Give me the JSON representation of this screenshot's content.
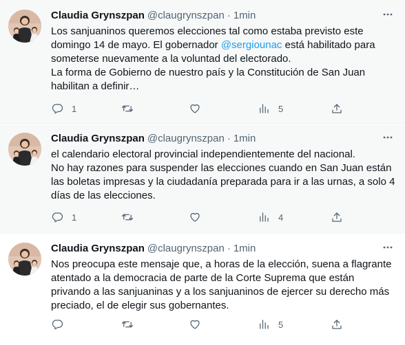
{
  "tweets": [
    {
      "author": "Claudia Grynszpan",
      "handle": "@claugrynszpan",
      "separator": "·",
      "time": "1min",
      "text_before_mention": "Los sanjuaninos queremos elecciones tal como estaba previsto este domingo 14 de mayo. El gobernador ",
      "mention": "@sergiounac",
      "text_after_mention": " está habilitado para someterse nuevamente a la voluntad del electorado.",
      "text_line2": "La forma de Gobierno de nuestro país y la Constitución de San Juan habilitan a definir…",
      "replies": "1",
      "retweets": "",
      "likes": "",
      "views": "5"
    },
    {
      "author": "Claudia Grynszpan",
      "handle": "@claugrynszpan",
      "separator": "·",
      "time": "1min",
      "text_line1": "el calendario electoral provincial independientemente del nacional.",
      "text_line2": "No hay razones para suspender las elecciones cuando en San Juan están las boletas impresas y la ciudadanía preparada para ir a las urnas, a solo 4 días de las elecciones.",
      "replies": "1",
      "retweets": "",
      "likes": "",
      "views": "4"
    },
    {
      "author": "Claudia Grynszpan",
      "handle": "@claugrynszpan",
      "separator": "·",
      "time": "1min",
      "text_line1": "Nos preocupa este mensaje que, a horas de la elección, suena a flagrante atentado a la democracia de parte de la Corte Suprema que están privando a las sanjuaninas y a los sanjuaninos de ejercer su derecho más preciado, el de elegir sus gobernantes.",
      "replies": "",
      "retweets": "",
      "likes": "",
      "views": "5"
    }
  ],
  "icons": {
    "reply": "reply-icon",
    "retweet": "retweet-icon",
    "like": "heart-icon",
    "views": "analytics-icon",
    "share": "share-icon",
    "more": "more-icon"
  },
  "colors": {
    "text": "#0f1419",
    "secondary": "#536471",
    "link": "#1d9bf0",
    "highlight_bg": "#f7f9f9",
    "divider": "#eff3f4"
  }
}
